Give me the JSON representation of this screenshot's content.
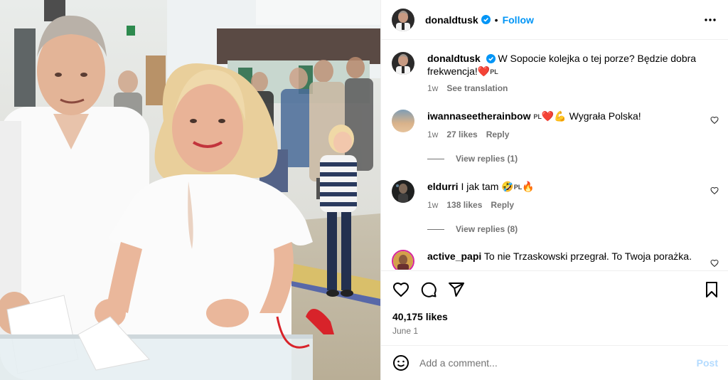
{
  "post": {
    "author": "donaldtusk",
    "follow_label": "Follow",
    "separator": "•",
    "caption_text": "W Sopocie kolejka o tej porze? Będzie dobra frekwencja!",
    "caption_emoji": "❤️",
    "caption_flag": "PL",
    "caption_time": "1w",
    "see_translation": "See translation",
    "likes": "40,175 likes",
    "date": "June 1"
  },
  "comments": [
    {
      "user": "iwannaseetherainbow",
      "flag": "PL",
      "emoji": "❤️💪",
      "text": "Wygrała Polska!",
      "time": "1w",
      "likes": "27 likes",
      "reply": "Reply",
      "view_replies": "View replies (1)"
    },
    {
      "user": "eldurri",
      "text": "I jak tam",
      "emoji_after": "🤣",
      "flag": "PL",
      "emoji_end": "🔥",
      "time": "1w",
      "likes": "138 likes",
      "reply": "Reply",
      "view_replies": "View replies (8)"
    },
    {
      "user": "active_papi",
      "text": "To nie Trzaskowski przegrał. To Twoja porażka."
    }
  ],
  "add_comment": {
    "placeholder": "Add a comment...",
    "post_label": "Post"
  },
  "icons": {
    "verified": "verified-badge-icon",
    "more": "more-options-icon",
    "like": "heart-icon",
    "comment": "comment-bubble-icon",
    "share": "share-paper-plane-icon",
    "save": "bookmark-icon",
    "emoji": "emoji-smiley-icon"
  },
  "colors": {
    "accent": "#0095f6",
    "post_disabled": "#b3dbff",
    "secondary_text": "#737373",
    "verified": "#0095f6",
    "heart": "#ed1c24"
  }
}
